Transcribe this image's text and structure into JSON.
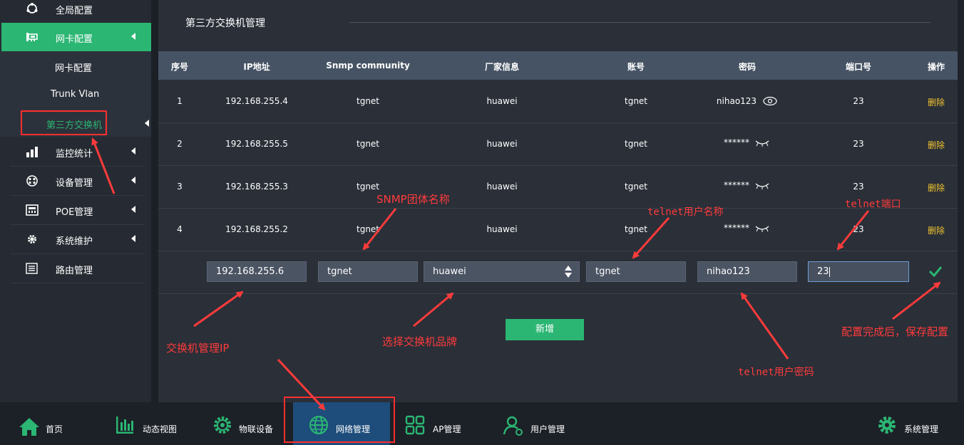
{
  "sidebar": {
    "items": [
      {
        "label": "全局配置"
      },
      {
        "label": "网卡配置"
      },
      {
        "label": "监控统计"
      },
      {
        "label": "设备管理"
      },
      {
        "label": "POE管理"
      },
      {
        "label": "系统维护"
      },
      {
        "label": "路由管理"
      }
    ],
    "subitems": [
      {
        "label": "网卡配置"
      },
      {
        "label": "Trunk Vlan"
      },
      {
        "label": "第三方交换机"
      }
    ]
  },
  "page": {
    "title": "第三方交换机管理"
  },
  "table": {
    "headers": [
      "序号",
      "IP地址",
      "Snmp community",
      "厂家信息",
      "账号",
      "密码",
      "端口号",
      "操作"
    ],
    "rows": [
      {
        "no": "1",
        "ip": "192.168.255.4",
        "community": "tgnet",
        "vendor": "huawei",
        "account": "tgnet",
        "password": "nihao123",
        "port": "23",
        "action": "删除"
      },
      {
        "no": "2",
        "ip": "192.168.255.5",
        "community": "tgnet",
        "vendor": "huawei",
        "account": "tgnet",
        "password": "******",
        "port": "23",
        "action": "删除"
      },
      {
        "no": "3",
        "ip": "192.168.255.3",
        "community": "tgnet",
        "vendor": "huawei",
        "account": "tgnet",
        "password": "******",
        "port": "23",
        "action": "删除"
      },
      {
        "no": "4",
        "ip": "192.168.255.2",
        "community": "tgnet",
        "vendor": "huawei",
        "account": "tgnet",
        "password": "******",
        "port": "23",
        "action": "删除"
      }
    ]
  },
  "form": {
    "ip": "192.168.255.6",
    "community": "tgnet",
    "vendor": "huawei",
    "account": "tgnet",
    "password": "nihao123",
    "port": "23",
    "add_label": "新增"
  },
  "bottom_nav": [
    {
      "label": "首页"
    },
    {
      "label": "动态视图"
    },
    {
      "label": "物联设备"
    },
    {
      "label": "网络管理"
    },
    {
      "label": "AP管理"
    },
    {
      "label": "用户管理"
    },
    {
      "label": "系统管理"
    }
  ],
  "annotations": {
    "snmp": "SNMP团体名称",
    "telnet_user": "telnet用户名称",
    "telnet_port": "telnet端口",
    "switch_ip": "交换机管理IP",
    "brand": "选择交换机品牌",
    "telnet_pwd": "telnet用户密码",
    "save": "配置完成后，保存配置"
  },
  "colors": {
    "accent": "#2bb673",
    "delete": "#f0c330",
    "annotation": "#ff3b3b",
    "header_bg": "#465364"
  }
}
